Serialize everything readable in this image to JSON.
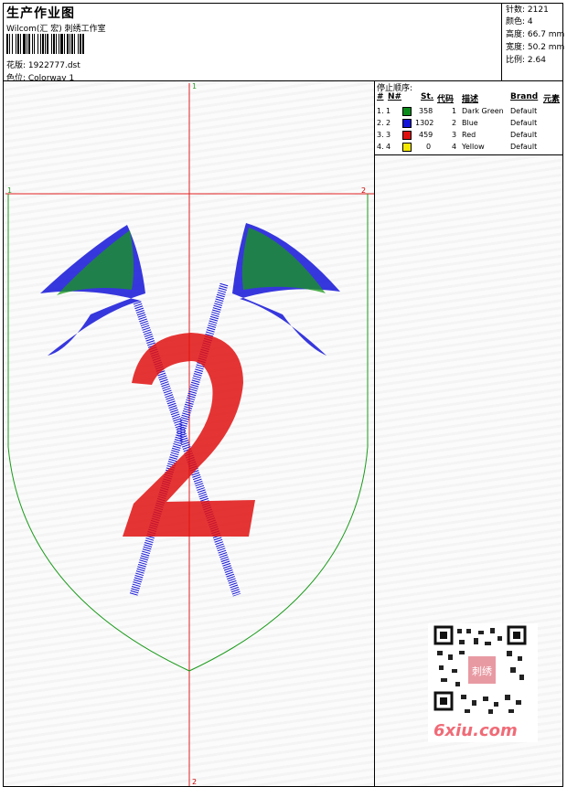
{
  "header": {
    "title": "生产作业图",
    "company": "Wilcom(汇 宏) 刺绣工作室",
    "design_label": "花版: 1922777.dst",
    "colorway_label": "色位: Colorway 1",
    "stats": [
      "针数: 2121",
      "颜色: 4",
      "高度: 66.7 mm",
      "宽度: 50.2 mm",
      "比例: 2.64"
    ]
  },
  "stop_sequence": {
    "title": "停止顺序:",
    "columns": [
      "#",
      "N#",
      "St.",
      "代码",
      "描述",
      "Brand",
      "元素"
    ],
    "rows": [
      {
        "seq": "1.",
        "n": "1",
        "color": "#0a8a1a",
        "stitches": "358",
        "code": "1",
        "desc": "Dark Green",
        "brand": "Default"
      },
      {
        "seq": "2.",
        "n": "2",
        "color": "#1414d8",
        "stitches": "1302",
        "code": "2",
        "desc": "Blue",
        "brand": "Default"
      },
      {
        "seq": "3.",
        "n": "3",
        "color": "#e01010",
        "stitches": "459",
        "code": "3",
        "desc": "Red",
        "brand": "Default"
      },
      {
        "seq": "4.",
        "n": "4",
        "color": "#f4e800",
        "stitches": "0",
        "code": "4",
        "desc": "Yellow",
        "brand": "Default"
      }
    ]
  },
  "canvas": {
    "guide_color": "#e02020",
    "outline_color": "#1a9a1a",
    "markers": {
      "top": "1",
      "bottom": "2",
      "left": "1",
      "right": "2"
    }
  },
  "watermark": {
    "brand_text": "6xiu.com",
    "stamp_text": "刺绣"
  }
}
